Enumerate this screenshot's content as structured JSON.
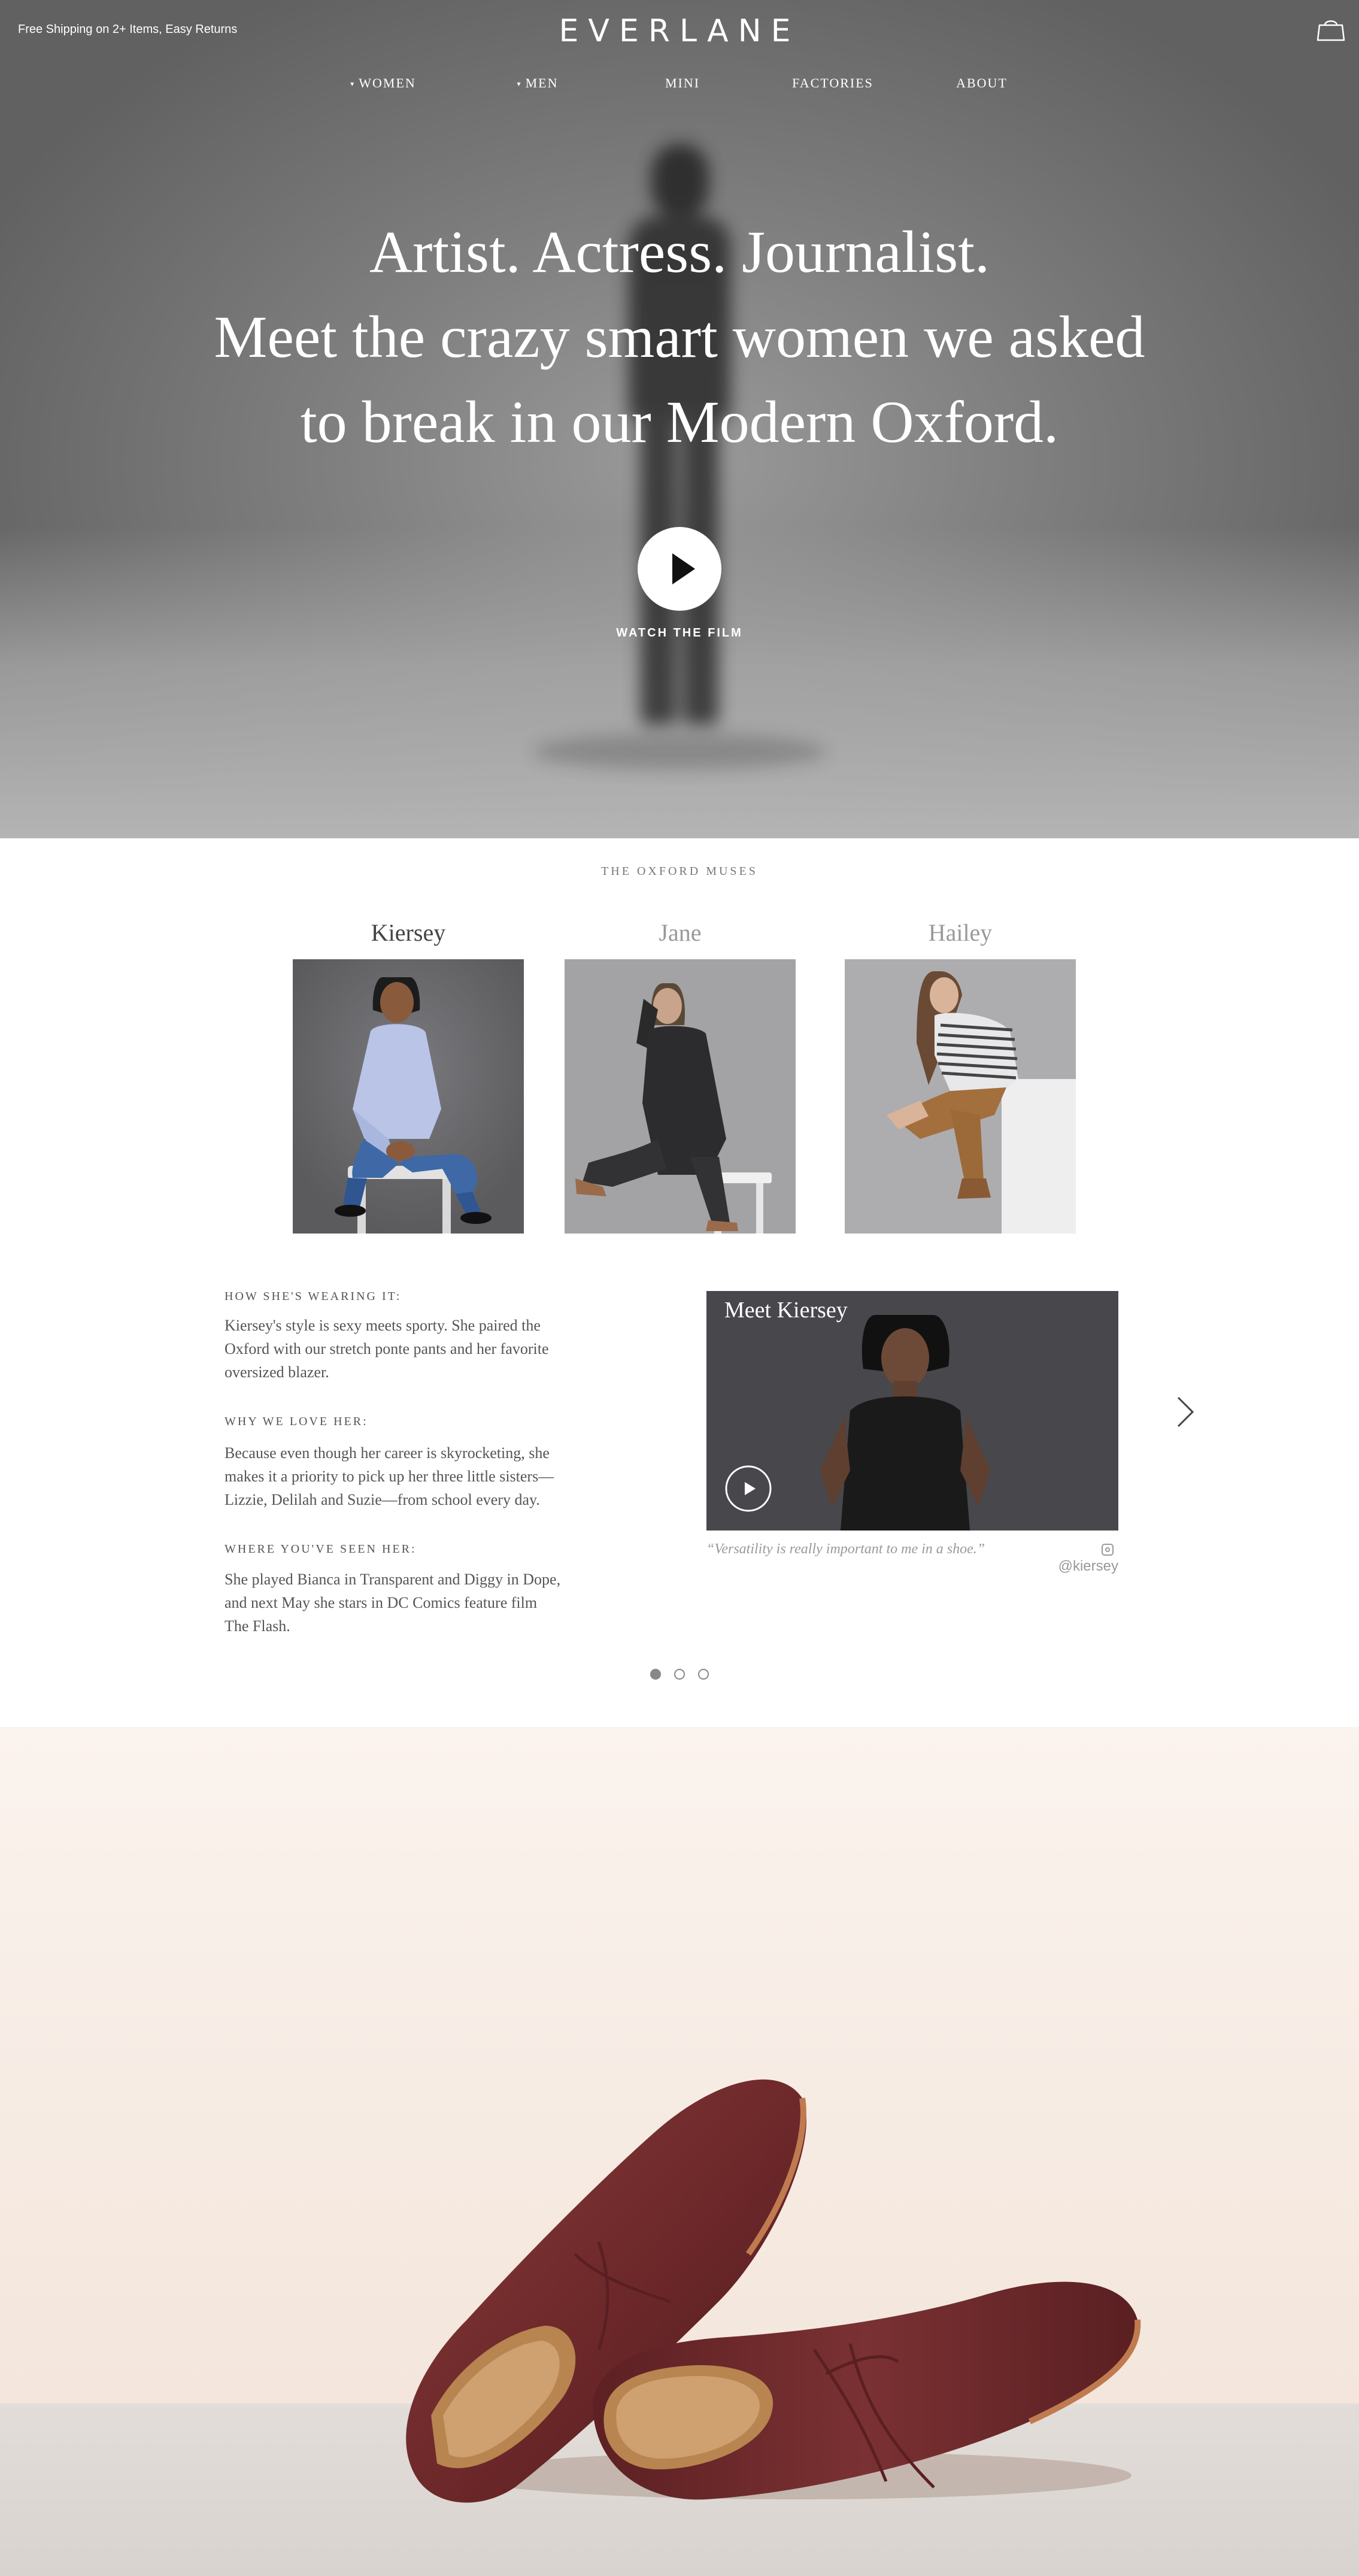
{
  "header": {
    "promo": "Free Shipping on 2+ Items, Easy Returns",
    "logo": "EVERLANE",
    "cart_icon": "shopping-bag-icon"
  },
  "nav": {
    "items": [
      {
        "label": "WOMEN",
        "has_dropdown": true
      },
      {
        "label": "MEN",
        "has_dropdown": true
      },
      {
        "label": "MINI",
        "has_dropdown": false
      },
      {
        "label": "FACTORIES",
        "has_dropdown": false
      },
      {
        "label": "ABOUT",
        "has_dropdown": false
      }
    ]
  },
  "hero": {
    "line1": "Artist. Actress. Journalist.",
    "line2": "Meet the crazy smart women we asked",
    "line3": "to break in our Modern Oxford.",
    "cta_label": "WATCH THE FILM",
    "play_icon": "play-icon"
  },
  "muses": {
    "section_label": "THE OXFORD MUSES",
    "names": [
      "Kiersey",
      "Jane",
      "Hailey"
    ],
    "active_index": 0
  },
  "detail": {
    "wearing_heading": "HOW SHE'S WEARING IT:",
    "wearing_lines": [
      "Kiersey's style is sexy meets sporty. She paired the",
      "Oxford with our stretch ponte pants and her favorite",
      "oversized blazer."
    ],
    "love_heading": "WHY WE LOVE HER:",
    "love_lines": [
      "Because even though her career is skyrocketing, she",
      "makes it a priority to pick up her three little sisters—",
      "Lizzie, Delilah and Suzie—from school every day."
    ],
    "seen_heading": "WHERE YOU'VE SEEN HER:",
    "seen_lines": [
      "She played Bianca in Transparent and Diggy in Dope,",
      "and next May she stars in DC Comics feature film",
      "The Flash."
    ],
    "video_title": "Meet Kiersey",
    "quote": "“Versatility is really important to me in a shoe.”",
    "handle": "@kiersey",
    "handle_icon": "instagram-icon",
    "next_icon": "chevron-right-icon"
  },
  "carousel": {
    "pages": 3,
    "current": 0
  },
  "colors": {
    "hero_grey": "#7f7f7f",
    "text_grey": "#555555",
    "shoe_leather": "#6f2a2a",
    "shoe_bg": "#f6ebe3"
  }
}
